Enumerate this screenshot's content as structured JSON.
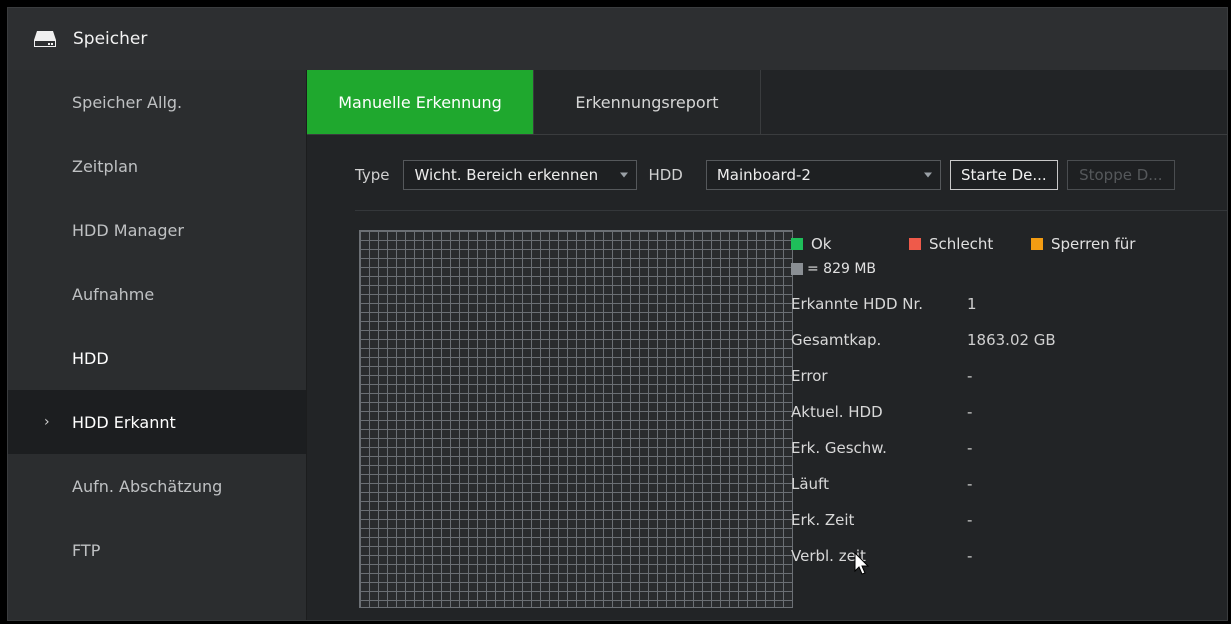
{
  "window": {
    "title": "Speicher",
    "icon": "hdd-icon"
  },
  "sidebar": {
    "items": [
      {
        "label": "Speicher Allg."
      },
      {
        "label": "Zeitplan"
      },
      {
        "label": "HDD Manager"
      },
      {
        "label": "Aufnahme"
      },
      {
        "label": "HDD"
      },
      {
        "label": "HDD Erkannt",
        "active": true
      },
      {
        "label": "Aufn. Abschätzung"
      },
      {
        "label": "FTP"
      }
    ],
    "active_marker": "›"
  },
  "tabs": [
    {
      "label": "Manuelle Erkennung",
      "active": true
    },
    {
      "label": "Erkennungsreport",
      "active": false
    }
  ],
  "toolbar": {
    "type_label": "Type",
    "type_value": "Wicht. Bereich erkennen",
    "hdd_label": "HDD",
    "hdd_value": "Mainboard-2",
    "start_button": "Starte De...",
    "stop_button": "Stoppe D..."
  },
  "legend": {
    "ok": "Ok",
    "bad": "Schlecht",
    "blocked": "Sperren für",
    "unit": "= 829 MB",
    "colors": {
      "ok": "#1fbf5a",
      "bad": "#ef5a4a",
      "blocked": "#f39c12",
      "unit": "#8a8f94"
    }
  },
  "info": [
    {
      "key": "Erkannte HDD Nr.",
      "value": "1"
    },
    {
      "key": "Gesamtkap.",
      "value": "1863.02 GB"
    },
    {
      "key": "Error",
      "value": "-"
    },
    {
      "key": "Aktuel. HDD",
      "value": "-"
    },
    {
      "key": "Erk. Geschw.",
      "value": "-"
    },
    {
      "key": "Läuft",
      "value": "-"
    },
    {
      "key": "Erk. Zeit",
      "value": "-"
    },
    {
      "key": "Verbl. zeit",
      "value": "-"
    }
  ],
  "theme": {
    "accent": "#1fa82e"
  }
}
